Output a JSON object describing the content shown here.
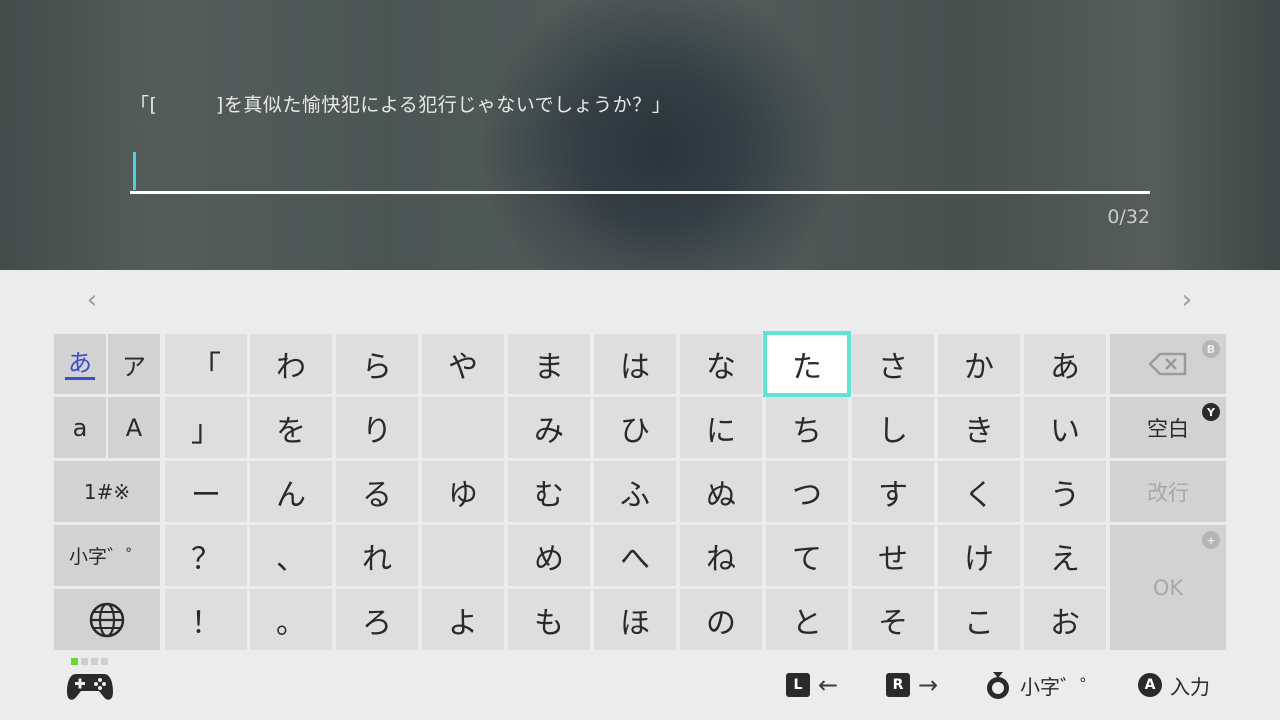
{
  "input": {
    "prompt": "「[　　　]を真似た愉快犯による犯行じゃないでしょうか？」",
    "counter": "0/32"
  },
  "nav": {
    "prev": "‹",
    "next": "›"
  },
  "modes": {
    "hiragana": "あ",
    "katakana": "ア",
    "lower": "a",
    "upper": "A",
    "symbols": "1#※",
    "small": "小字゛゜"
  },
  "keys": [
    [
      "「",
      "わ",
      "ら",
      "や",
      "ま",
      "は",
      "な",
      "た",
      "さ",
      "か",
      "あ"
    ],
    [
      "」",
      "を",
      "り",
      "",
      "み",
      "ひ",
      "に",
      "ち",
      "し",
      "き",
      "い"
    ],
    [
      "ー",
      "ん",
      "る",
      "ゆ",
      "む",
      "ふ",
      "ぬ",
      "つ",
      "す",
      "く",
      "う"
    ],
    [
      "？",
      "、",
      "れ",
      "",
      "め",
      "へ",
      "ね",
      "て",
      "せ",
      "け",
      "え"
    ],
    [
      "！",
      "。",
      "ろ",
      "よ",
      "も",
      "ほ",
      "の",
      "と",
      "そ",
      "こ",
      "お"
    ]
  ],
  "side": {
    "backspace_badge": "B",
    "space": "空白",
    "space_badge": "Y",
    "newline": "改行",
    "ok": "OK",
    "ok_badge": "+"
  },
  "footer": {
    "l_button": "L",
    "l_arrow": "←",
    "r_button": "R",
    "r_arrow": "→",
    "stick_label": "小字゛゜",
    "a_button": "A",
    "a_label": "入力"
  },
  "colors": {
    "accent_cursor": "#4ad1dc",
    "selected_outline": "#5ee3d6",
    "active_mode": "#3a4fd0",
    "page_indicator_on": "#6ed23a"
  }
}
